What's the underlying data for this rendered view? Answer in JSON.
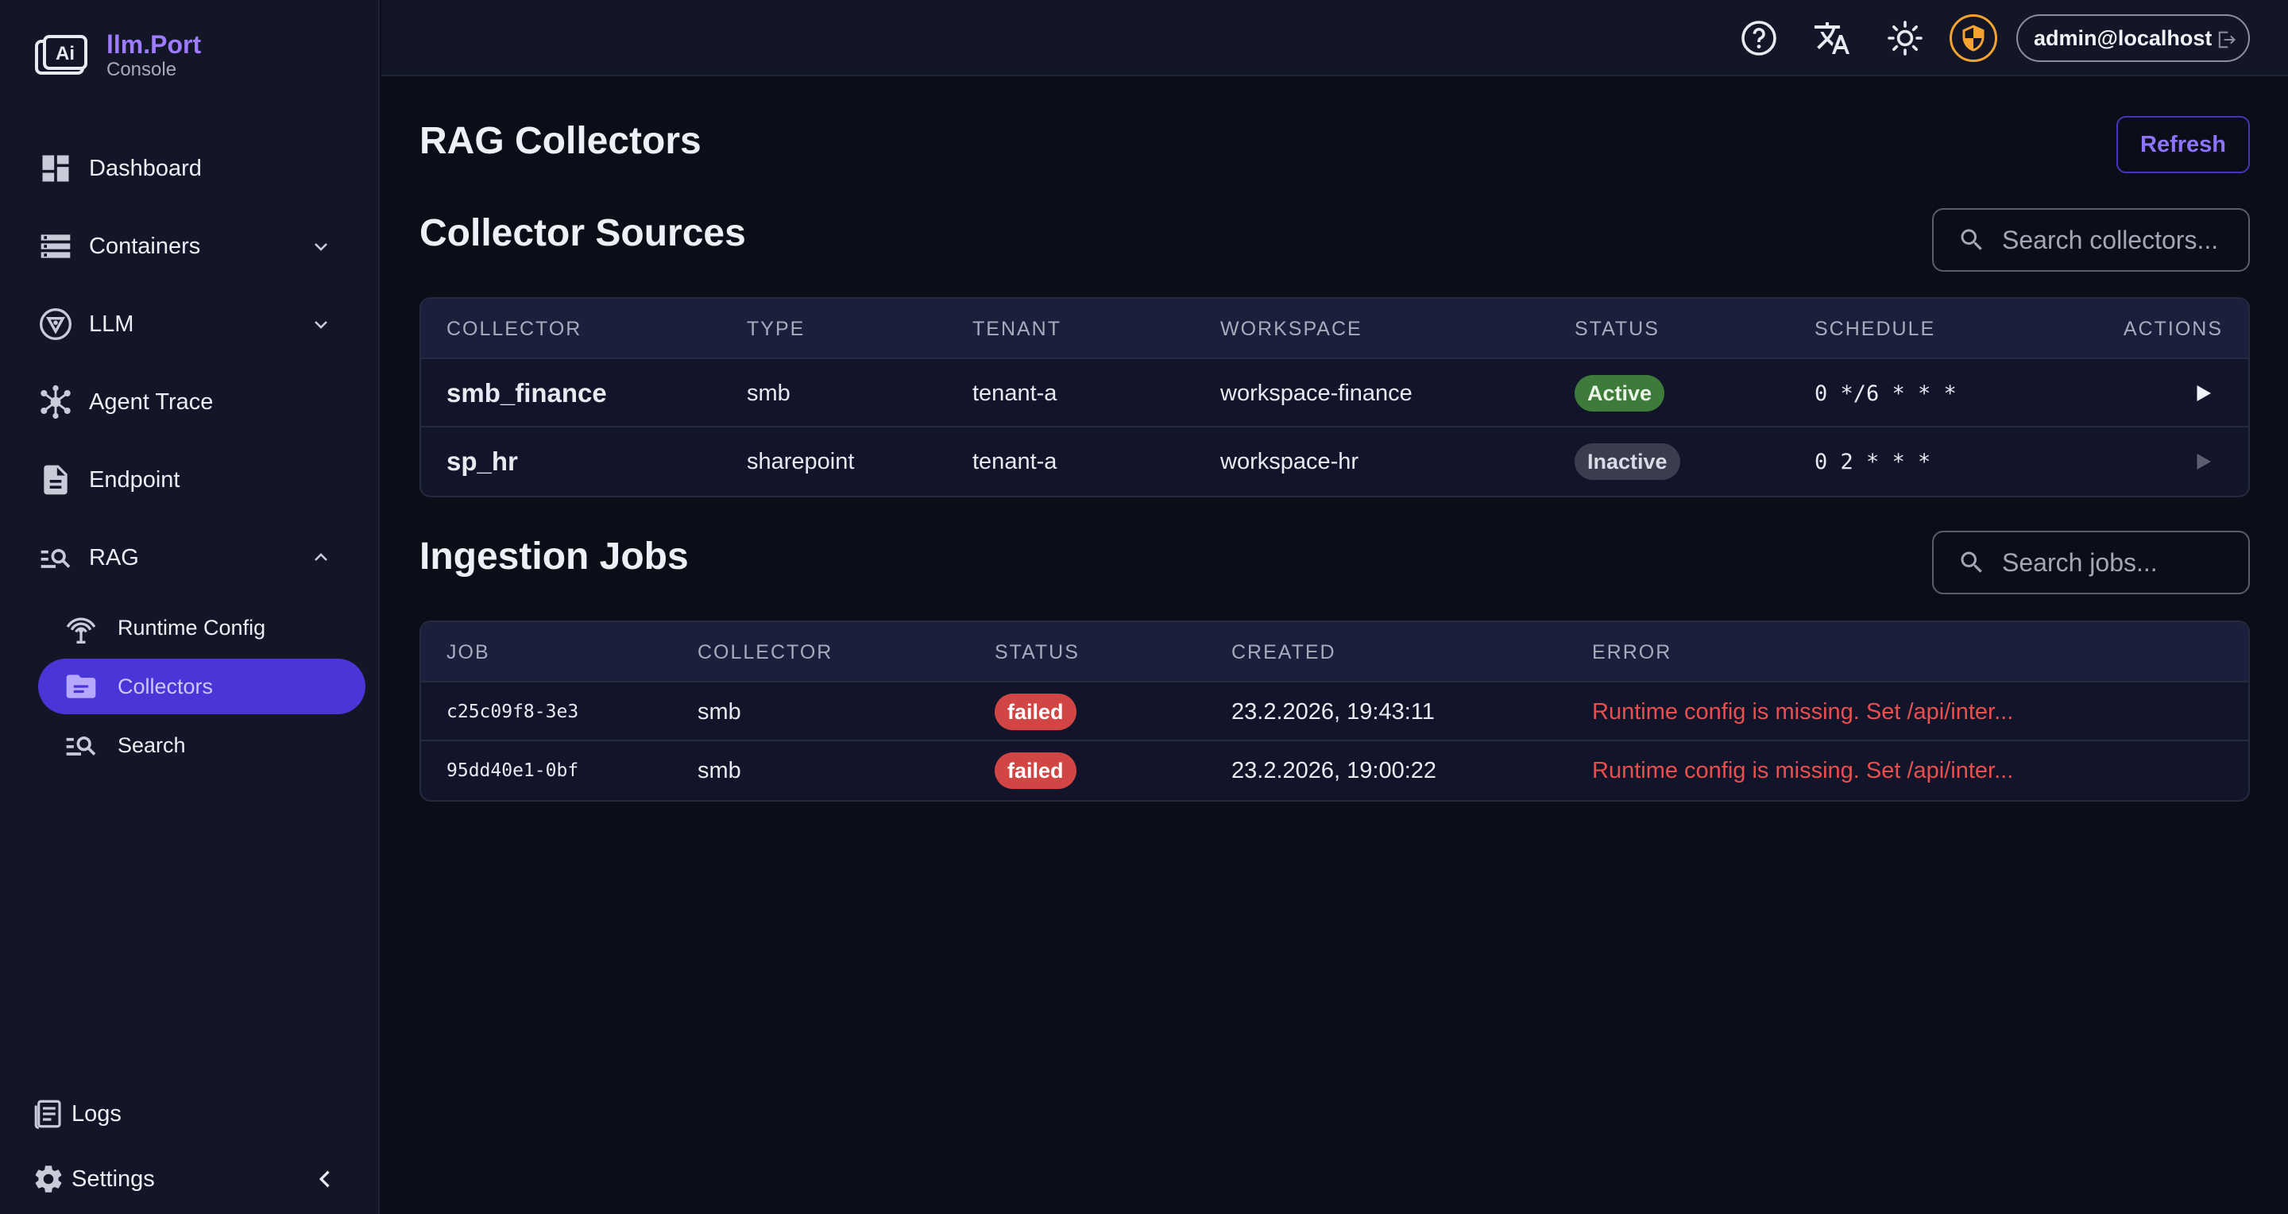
{
  "brand": {
    "name": "llm.Port",
    "subtitle": "Console"
  },
  "sidebar": {
    "items": [
      {
        "label": "Dashboard"
      },
      {
        "label": "Containers"
      },
      {
        "label": "LLM"
      },
      {
        "label": "Agent Trace"
      },
      {
        "label": "Endpoint"
      },
      {
        "label": "RAG"
      }
    ],
    "rag_children": [
      {
        "label": "Runtime Config"
      },
      {
        "label": "Collectors"
      },
      {
        "label": "Search"
      }
    ],
    "bottom": [
      {
        "label": "Logs"
      },
      {
        "label": "Settings"
      }
    ],
    "active_color": "#4a35d6"
  },
  "topbar": {
    "user": "admin@localhost"
  },
  "page": {
    "title": "RAG Collectors",
    "refresh_label": "Refresh"
  },
  "collectors": {
    "title": "Collector Sources",
    "search_placeholder": "Search collectors...",
    "columns": [
      "COLLECTOR",
      "TYPE",
      "TENANT",
      "WORKSPACE",
      "STATUS",
      "SCHEDULE",
      "ACTIONS"
    ],
    "rows": [
      {
        "name": "smb_finance",
        "type": "smb",
        "tenant": "tenant-a",
        "workspace": "workspace-finance",
        "status": "Active",
        "schedule": "0 */6 * * *"
      },
      {
        "name": "sp_hr",
        "type": "sharepoint",
        "tenant": "tenant-a",
        "workspace": "workspace-hr",
        "status": "Inactive",
        "schedule": "0 2 * * *"
      }
    ]
  },
  "jobs": {
    "title": "Ingestion Jobs",
    "search_placeholder": "Search jobs...",
    "columns": [
      "JOB",
      "COLLECTOR",
      "STATUS",
      "CREATED",
      "ERROR"
    ],
    "rows": [
      {
        "job": "c25c09f8-3e3",
        "collector": "smb",
        "status": "failed",
        "created": "23.2.2026, 19:43:11",
        "error": "Runtime config is missing. Set /api/inter..."
      },
      {
        "job": "95dd40e1-0bf",
        "collector": "smb",
        "status": "failed",
        "created": "23.2.2026, 19:00:22",
        "error": "Runtime config is missing. Set /api/inter..."
      }
    ]
  },
  "colors": {
    "accent": "#8e73ff",
    "active_badge": "#3e7b3a",
    "failed_badge": "#d14545",
    "error_text": "#ea4f4f",
    "shield": "#f4a230"
  }
}
